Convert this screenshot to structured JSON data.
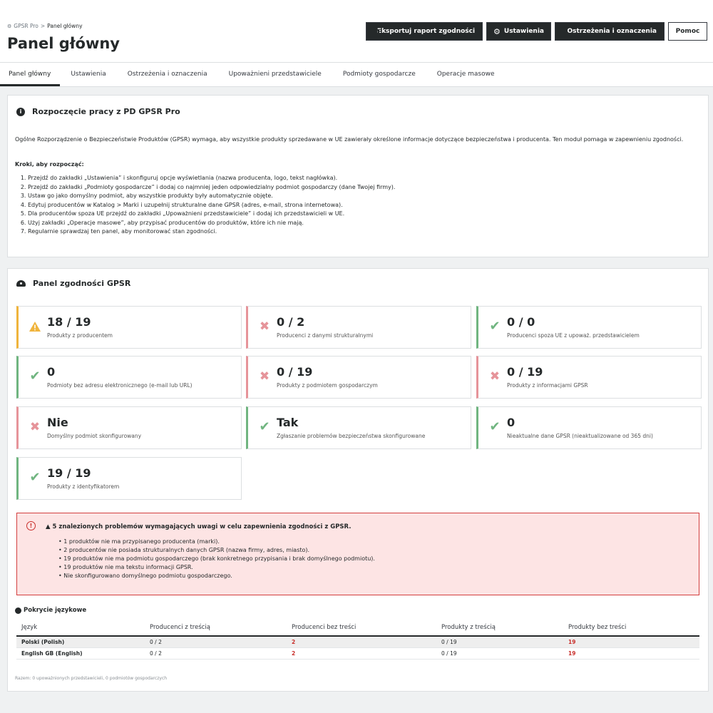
{
  "header": {
    "breadcrumb": [
      "GPSR Pro",
      "Panel główny"
    ],
    "breadcrumb_sep": ">",
    "title": "Panel główny",
    "buttons": {
      "export": "Eksportuj raport zgodności",
      "settings": "Ustawienia",
      "warnings": "Ostrzeżenia i oznaczenia",
      "help": "Pomoc"
    }
  },
  "tabs": [
    "Panel główny",
    "Ustawienia",
    "Ostrzeżenia i oznaczenia",
    "Upoważnieni przedstawiciele",
    "Podmioty gospodarcze",
    "Operacje masowe"
  ],
  "intro": {
    "title": "Rozpoczęcie pracy z PD GPSR Pro",
    "description": "Ogólne Rozporządzenie o Bezpieczeństwie Produktów (GPSR) wymaga, aby wszystkie produkty sprzedawane w UE zawierały określone informacje dotyczące bezpieczeństwa i producenta. Ten moduł pomaga w zapewnieniu zgodności.",
    "steps_title": "Kroki, aby rozpocząć:",
    "steps": [
      "Przejdź do zakładki „Ustawienia” i skonfiguruj opcje wyświetlania (nazwa producenta, logo, tekst nagłówka).",
      "Przejdź do zakładki „Podmioty gospodarcze” i dodaj co najmniej jeden odpowiedzialny podmiot gospodarczy (dane Twojej firmy).",
      "Ustaw go jako domyślny podmiot, aby wszystkie produkty były automatycznie objęte.",
      "Edytuj producentów w Katalog > Marki i uzupełnij strukturalne dane GPSR (adres, e-mail, strona internetowa).",
      "Dla producentów spoza UE przejdź do zakładki „Upoważnieni przedstawiciele” i dodaj ich przedstawicieli w UE.",
      "Użyj zakładki „Operacje masowe”, aby przypisać producentów do produktów, które ich nie mają.",
      "Regularnie sprawdzaj ten panel, aby monitorować stan zgodności."
    ]
  },
  "dashboard": {
    "title": "Panel zgodności GPSR",
    "metrics": [
      {
        "value": "18 / 19",
        "label": "Produkty z producentem",
        "status": "warn"
      },
      {
        "value": "0 / 2",
        "label": "Producenci z danymi strukturalnymi",
        "status": "bad"
      },
      {
        "value": "0 / 0",
        "label": "Producenci spoza UE z upoważ. przedstawicielem",
        "status": "ok"
      },
      {
        "value": "0",
        "label": "Podmioty bez adresu elektronicznego (e-mail lub URL)",
        "status": "ok"
      },
      {
        "value": "0 / 19",
        "label": "Produkty z podmiotem gospodarczym",
        "status": "bad"
      },
      {
        "value": "0 / 19",
        "label": "Produkty z informacjami GPSR",
        "status": "bad"
      },
      {
        "value": "Nie",
        "label": "Domyślny podmiot skonfigurowany",
        "status": "bad"
      },
      {
        "value": "Tak",
        "label": "Zgłaszanie problemów bezpieczeństwa skonfigurowane",
        "status": "ok"
      },
      {
        "value": "0",
        "label": "Nieaktualne dane GPSR (nieaktualizowane od 365 dni)",
        "status": "ok"
      },
      {
        "value": "19 / 19",
        "label": "Produkty z identyfikatorem",
        "status": "ok"
      }
    ],
    "alert": {
      "title": "▲ 5 znalezionych problemów wymagających uwagi w celu zapewnienia zgodności z GPSR.",
      "items": [
        "1 produktów nie ma przypisanego producenta (marki).",
        "2 producentów nie posiada strukturalnych danych GPSR (nazwa firmy, adres, miasto).",
        "19 produktów nie ma podmiotu gospodarczego (brak konkretnego przypisania i brak domyślnego podmiotu).",
        "19 produktów nie ma tekstu informacji GPSR.",
        "Nie skonfigurowano domyślnego podmiotu gospodarczego."
      ]
    },
    "language": {
      "title": "Pokrycie językowe",
      "headers": [
        "Język",
        "Producenci z treścią",
        "Producenci bez treści",
        "Produkty z treścią",
        "Produkty bez treści"
      ],
      "rows": [
        [
          "Polski (Polish)",
          "0 / 2",
          "2",
          "0 / 19",
          "19"
        ],
        [
          "English GB (English)",
          "0 / 2",
          "2",
          "0 / 19",
          "19"
        ]
      ],
      "footer": "Razem: 0 upoważnionych przedstawicieli, 0 podmiotów gospodarczych"
    }
  },
  "colors": {
    "warn": "#f0b43c",
    "bad": "#e6949a",
    "ok": "#70b580",
    "danger": "#c9302c",
    "alert_bg": "#fde4e4"
  }
}
